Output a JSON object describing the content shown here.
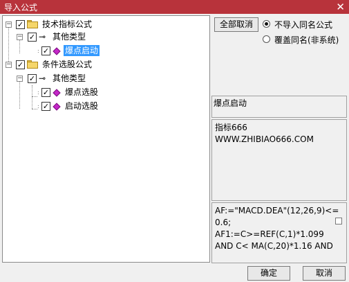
{
  "window": {
    "title": "导入公式",
    "close_glyph": "✕"
  },
  "tree": {
    "nodes": [
      {
        "label": "技术指标公式",
        "expander": "−",
        "checked": true
      },
      {
        "label": "其他类型",
        "expander": "−",
        "checked": true
      },
      {
        "label": "爆点启动",
        "checked": true,
        "selected": true
      },
      {
        "label": "条件选股公式",
        "expander": "−",
        "checked": true
      },
      {
        "label": "其他类型",
        "expander": "−",
        "checked": true
      },
      {
        "label": "爆点选股",
        "checked": true
      },
      {
        "label": "启动选股",
        "checked": true
      }
    ]
  },
  "right": {
    "cancel_all_button": "全部取消",
    "radio_no_import": "不导入同名公式",
    "radio_overwrite": "覆盖同名(非系统)",
    "formula_name": "爆点启动",
    "description_line1": "指标666",
    "description_line2": "WWW.ZHIBIAO666.COM",
    "code_line1": "AF:=\"MACD.DEA\"(12,26,9)<=",
    "code_line2": "0.6;",
    "code_line3": "AF1:=C>=REF(C,1)*1.099",
    "code_line4": "AND C< MA(C,20)*1.16 AND"
  },
  "footer": {
    "ok_button": "确定",
    "cancel_button": "取消"
  },
  "colors": {
    "titlebar": "#b8333b",
    "selection": "#3399ff",
    "gem": "#c428c8",
    "folder": "#f5d66a"
  },
  "icons": {
    "folder": "folder-icon",
    "key": "key-icon",
    "gem": "formula-gem-icon"
  }
}
